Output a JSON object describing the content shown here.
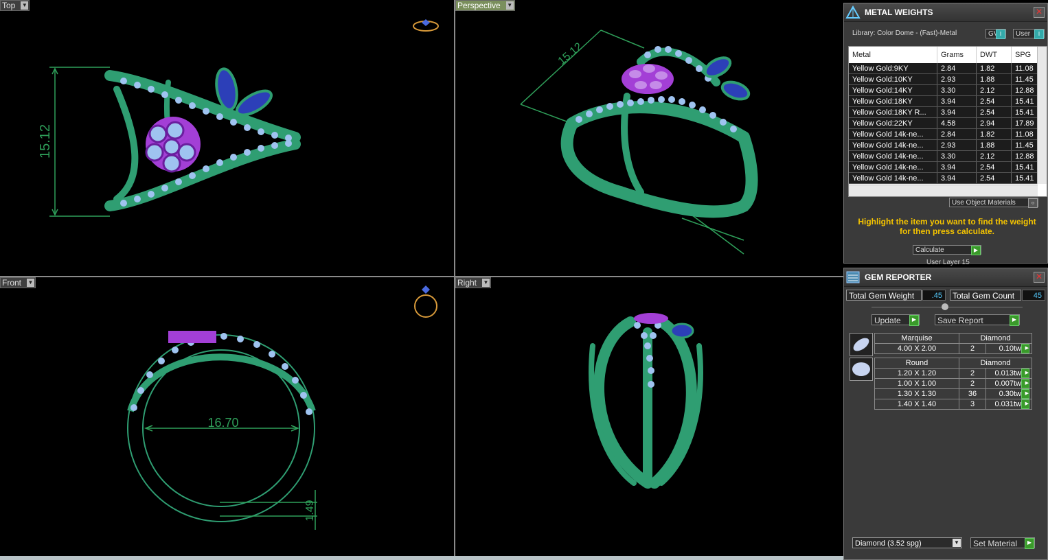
{
  "viewports": {
    "top": {
      "label": "Top",
      "dimension": "15.12"
    },
    "perspective": {
      "label": "Perspective",
      "dimension": "15.12"
    },
    "front": {
      "label": "Front",
      "dimension": "16.70",
      "dimension2": "1.49"
    },
    "right": {
      "label": "Right"
    }
  },
  "metal_weights": {
    "title": "METAL WEIGHTS",
    "library": "Library: Color Dome - (Fast)-Metal",
    "gv_label": "GV",
    "user_label": "User",
    "columns": [
      "Metal",
      "Grams",
      "DWT",
      "SPG"
    ],
    "rows": [
      [
        "Yellow Gold:9KY",
        "2.84",
        "1.82",
        "11.08"
      ],
      [
        "Yellow Gold:10KY",
        "2.93",
        "1.88",
        "11.45"
      ],
      [
        "Yellow Gold:14KY",
        "3.30",
        "2.12",
        "12.88"
      ],
      [
        "Yellow Gold:18KY",
        "3.94",
        "2.54",
        "15.41"
      ],
      [
        "Yellow Gold:18KY R...",
        "3.94",
        "2.54",
        "15.41"
      ],
      [
        "Yellow Gold:22KY",
        "4.58",
        "2.94",
        "17.89"
      ],
      [
        "Yellow Gold 14k-ne...",
        "2.84",
        "1.82",
        "11.08"
      ],
      [
        "Yellow Gold 14k-ne...",
        "2.93",
        "1.88",
        "11.45"
      ],
      [
        "Yellow Gold 14k-ne...",
        "3.30",
        "2.12",
        "12.88"
      ],
      [
        "Yellow Gold 14k-ne...",
        "3.94",
        "2.54",
        "15.41"
      ],
      [
        "Yellow Gold 14k-ne...",
        "3.94",
        "2.54",
        "15.41"
      ]
    ],
    "use_object_materials": "Use Object Materials",
    "instruction": "Highlight the item you want to find the weight for then press calculate.",
    "calculate": "Calculate",
    "behind_text": "User Layer 15"
  },
  "gem_reporter": {
    "title": "GEM REPORTER",
    "total_weight_label": "Total Gem Weight",
    "total_weight": ".45",
    "total_count_label": "Total Gem Count",
    "total_count": "45",
    "update": "Update",
    "save_report": "Save Report",
    "groups": [
      {
        "shape": "Marquise",
        "material": "Diamond",
        "rows": [
          [
            "4.00 X 2.00",
            "2",
            "0.10tw"
          ]
        ]
      },
      {
        "shape": "Round",
        "material": "Diamond",
        "rows": [
          [
            "1.20 X 1.20",
            "2",
            "0.013tw"
          ],
          [
            "1.00 X 1.00",
            "2",
            "0.007tw"
          ],
          [
            "1.30 X 1.30",
            "36",
            "0.30tw"
          ],
          [
            "1.40 X 1.40",
            "3",
            "0.031tw"
          ]
        ]
      }
    ],
    "material_select": "Diamond     (3.52 spg)",
    "set_material": "Set Material"
  },
  "colors": {
    "metal": "#2f9e72",
    "gem_light": "#9fc3f0",
    "gem_purple": "#a33fd6",
    "gem_blue": "#2c3fb8",
    "dimension": "#2fa05a"
  }
}
